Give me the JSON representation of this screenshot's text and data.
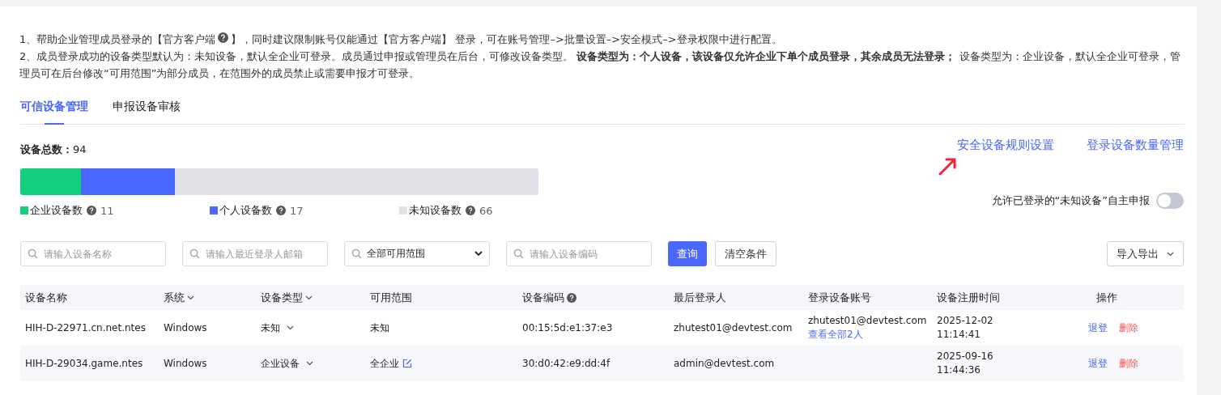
{
  "intro": {
    "line1_before": "1、帮助企业管理成员登录的【官方客户端",
    "line1_after": "】，同时建议限制账号仅能通过【官方客户端】 登录，可在账号管理–>批量设置–>安全模式–>登录权限中进行配置。",
    "line2": "2、成员登录成功的设备类型默认为：未知设备，默认全企业可登录。成员通过申报或管理员在后台，可修改设备类型。 **设备类型为：个人设备，该设备仅允许企业下单个成员登录，其余成员无法登录；** 设备类型为：企业设备，默认全企业可登录，管理员可在后台修改“可用范围”为部分成员，在范围外的成员禁止或需要申报才可登录。"
  },
  "tabs": [
    {
      "label": "可信设备管理",
      "selected": true
    },
    {
      "label": "申报设备审核",
      "selected": false
    }
  ],
  "total": {
    "label": "设备总数：",
    "value": "94"
  },
  "links": [
    "安全设备规则设置",
    "登录设备数量管理"
  ],
  "segments": [
    {
      "label": "企业设备数",
      "count": "11",
      "color": "#13d07f"
    },
    {
      "label": "个人设备数",
      "count": "17",
      "color": "#4a68ff"
    },
    {
      "label": "未知设备数",
      "count": "66",
      "color": "#e1e2e7"
    }
  ],
  "self_report": {
    "label": "允许已登录的“未知设备”自主申报",
    "on": false
  },
  "filters": [
    {
      "kind": "search",
      "placeholder": "请输入设备名称"
    },
    {
      "kind": "search",
      "placeholder": "请输入最近登录人邮箱"
    },
    {
      "kind": "select",
      "value": "全部可用范围"
    },
    {
      "kind": "search",
      "placeholder": "请输入设备编码"
    }
  ],
  "query_button": "查询",
  "clear_button": "清空条件",
  "export_button": "导入导出",
  "columns": [
    {
      "label": "设备名称",
      "kind": "plain"
    },
    {
      "label": "系统",
      "kind": "sort"
    },
    {
      "label": "设备类型",
      "kind": "sort"
    },
    {
      "label": "可用范围",
      "kind": "plain"
    },
    {
      "label": "设备编码",
      "kind": "help"
    },
    {
      "label": "最后登录人",
      "kind": "plain"
    },
    {
      "label": "登录设备账号",
      "kind": "plain"
    },
    {
      "label": "设备注册时间",
      "kind": "plain"
    },
    {
      "label": "操作",
      "kind": "plain"
    }
  ],
  "rows": [
    {
      "name": "HIH-D-22971.cn.net.ntes",
      "system": "Windows",
      "type": "未知",
      "range": "未知",
      "editable": false,
      "code": "00:15:5d:e1:37:e3",
      "last_login": "zhutest01@devtest.com",
      "account": "zhutest01@devtest.com",
      "account_link": "查看全部2人",
      "date": "2025-12-02",
      "time": "11:14:41",
      "actions": [
        {
          "label": "退登",
          "kind": "primary"
        },
        {
          "label": "删除",
          "kind": "danger"
        }
      ]
    },
    {
      "name": "HIH-D-29034.game.ntes",
      "system": "Windows",
      "type": "企业设备",
      "range": "全企业",
      "editable": true,
      "code": "30:d0:42:e9:dd:4f",
      "last_login": "admin@devtest.com",
      "date": "2025-09-16",
      "time": "11:44:36",
      "actions": [
        {
          "label": "退登",
          "kind": "primary"
        },
        {
          "label": "删除",
          "kind": "danger"
        }
      ]
    }
  ]
}
